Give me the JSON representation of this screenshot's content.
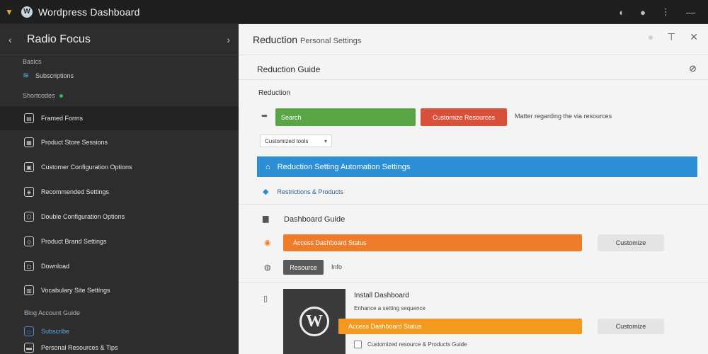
{
  "titlebar": {
    "title": "Wordpress Dashboard",
    "icons": [
      "app-icon",
      "wordpress-icon",
      "shield-icon",
      "user-icon",
      "more-icon",
      "minimize-icon"
    ]
  },
  "sidebar": {
    "title": "Radio Focus",
    "section1": "Basics",
    "wifi_item": "Subscriptions",
    "section2": "Shortcodes",
    "items": [
      {
        "label": "Framed Forms"
      },
      {
        "label": "Product Store Sessions"
      },
      {
        "label": "Customer Configuration Options"
      },
      {
        "label": "Recommended Settings"
      },
      {
        "label": "Double Configuration Options"
      },
      {
        "label": "Product Brand Settings"
      },
      {
        "label": "Download"
      },
      {
        "label": "Vocabulary Site Settings"
      }
    ],
    "section3": "Blog Account Guide",
    "blue_item": "Subscribe",
    "last_item": "Personal Resources & Tips"
  },
  "main": {
    "title": "Reduction",
    "subtitle": "Personal Settings",
    "section_title": "Reduction Guide",
    "sub_heading": "Reduction",
    "green_btn": "Search",
    "red_btn": "Customize Resources",
    "note": "Matter regarding the via resources",
    "select_value": "Customized tools",
    "blue_bar": "Reduction Setting Automation Settings",
    "link_row": "Restrictions & Products",
    "section2": "Dashboard Guide",
    "orange_bar": "Access Dashboard Status",
    "gray_btn1": "Customize",
    "dark_btn": "Resource",
    "dark_note": "Info",
    "card_title": "Install Dashboard",
    "card_sub": "Enhance a setting sequence",
    "orange_bar2": "Access Dashboard Status",
    "gray_btn2": "Customize",
    "checkbox_text": "Customized resource & Products Guide"
  }
}
